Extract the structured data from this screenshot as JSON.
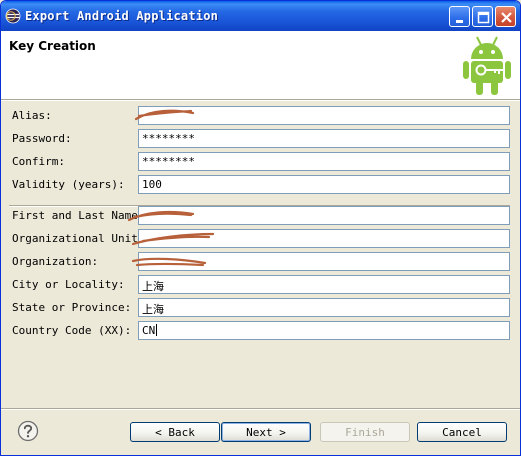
{
  "window": {
    "title": "Export Android Application"
  },
  "header": {
    "title": "Key Creation"
  },
  "icons": {
    "app": "eclipse-icon",
    "logo": "android-keystore-icon",
    "help": "help-icon"
  },
  "fields": {
    "alias": {
      "label": "Alias:",
      "value": ""
    },
    "password": {
      "label": "Password:",
      "value": "********"
    },
    "confirm": {
      "label": "Confirm:",
      "value": "********"
    },
    "validity": {
      "label": "Validity (years):",
      "value": "100"
    },
    "name": {
      "label": "First and Last Name:",
      "value": ""
    },
    "unit": {
      "label": "Organizational Unit:",
      "value": ""
    },
    "organization": {
      "label": "Organization:",
      "value": ""
    },
    "city": {
      "label": "City or Locality:",
      "value": "上海"
    },
    "state": {
      "label": "State or Province:",
      "value": "上海"
    },
    "country": {
      "label": "Country Code (XX):",
      "value": "CN"
    }
  },
  "buttons": {
    "back": "< Back",
    "next": "Next >",
    "finish": "Finish",
    "cancel": "Cancel"
  },
  "colors": {
    "titlebar": "#1a55d8",
    "redaction": "#b8603a",
    "android_green": "#8cc63f"
  }
}
